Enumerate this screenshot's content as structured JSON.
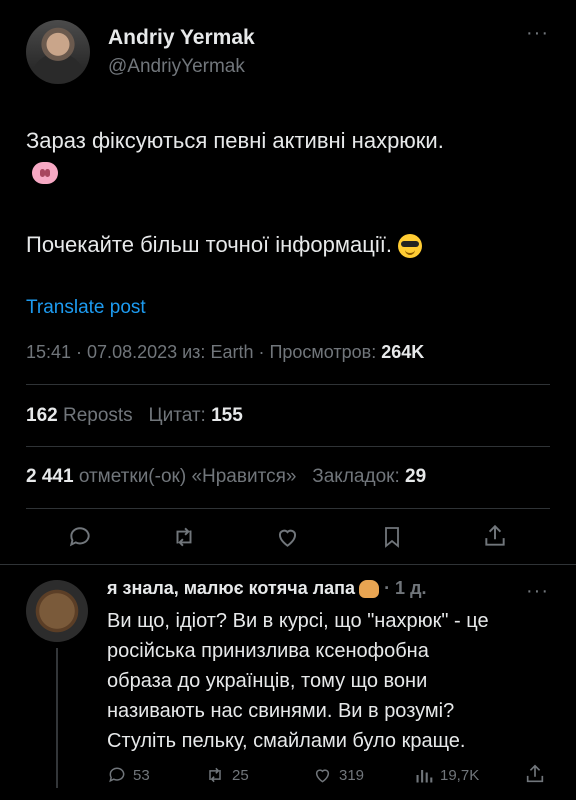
{
  "header": {
    "name": "Andriy Yermak",
    "handle": "@AndriyYermak",
    "more": "···"
  },
  "post": {
    "line1": "Зараз фіксуються певні активні нахрюки.",
    "line2": "Почекайте більш точної інформації.",
    "translate": "Translate post",
    "meta_prefix": "15:41 · 07.08.2023 из: Earth · Просмотров:",
    "views": "264K"
  },
  "stats": {
    "reposts_count": "162",
    "reposts_label": "Reposts",
    "quotes_label": "Цитат:",
    "quotes_count": "155",
    "likes_count": "2 441",
    "likes_label": "отметки(-ок) «Нравится»",
    "bookmarks_label": "Закладок:",
    "bookmarks_count": "29"
  },
  "icons": [
    "reply-icon",
    "repost-icon",
    "like-icon",
    "bookmark-icon",
    "share-icon"
  ],
  "reply": {
    "author": "я знала, малює котяча лапа",
    "time": "· 1 д.",
    "more": "···",
    "lines": [
      "Ви що, ідіот? Ви в курсі, що \"нахрюк\" - це",
      "російська принизлива ксенофобна",
      "образа до українців, тому що вони",
      "називають нас свинями. Ви в розумі?",
      "Стуліть пельку, смайлами було краще."
    ],
    "replies": "53",
    "reposts": "25",
    "likes": "319",
    "views": "19,7K"
  },
  "colors": {
    "accent": "#1d9bf0",
    "muted": "#71767b",
    "text": "#e7e9ea",
    "divider": "#2f3336"
  }
}
